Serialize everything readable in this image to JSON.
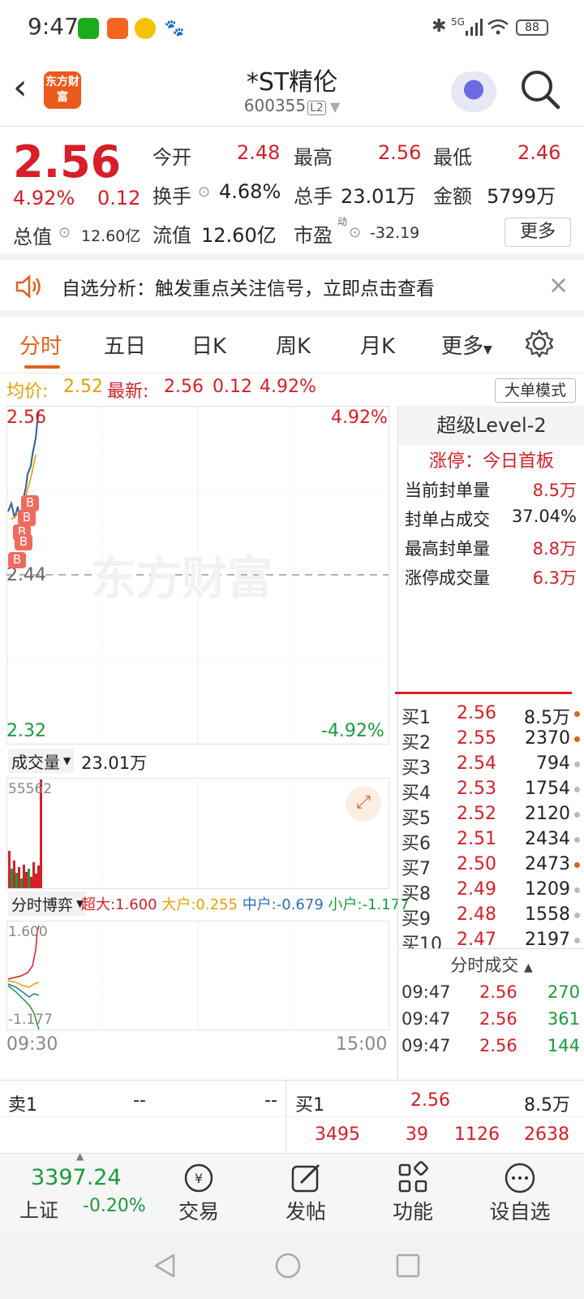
{
  "status_bar": {
    "time": "9:47",
    "battery": "88",
    "signal": "5G"
  },
  "header": {
    "back": "‹",
    "logo_text": "东方财富",
    "stock_name": "*ST精伦",
    "stock_code": "600355",
    "level_badge": "L2"
  },
  "quote": {
    "price": "2.56",
    "change_pct": "4.92%",
    "change_amt": "0.12",
    "open_label": "今开",
    "open": "2.48",
    "high_label": "最高",
    "high": "2.56",
    "low_label": "最低",
    "low": "2.46",
    "turnover_label": "换手",
    "turnover": "4.68%",
    "volume_label": "总手",
    "volume": "23.01万",
    "amount_label": "金额",
    "amount": "5799万",
    "mktcap_label": "总值",
    "mktcap": "12.60亿",
    "float_label": "流值",
    "float_cap": "12.60亿",
    "pe_label": "市盈",
    "pe_sup": "动",
    "pe": "-32.19",
    "more_label": "更多"
  },
  "notice": {
    "text": "自选分析：触发重点关注信号，立即点击查看",
    "close": "×"
  },
  "tabs": [
    "分时",
    "五日",
    "日K",
    "周K",
    "月K",
    "更多",
    "设置"
  ],
  "info_row": {
    "avg_label": "均价:",
    "avg": "2.52",
    "latest_label": "最新:",
    "latest": "2.56",
    "chg": "0.12",
    "pct": "4.92%",
    "big_order_btn": "大单模式"
  },
  "chart": {
    "top_price": "2.56",
    "top_pct": "4.92%",
    "mid_price": "2.44",
    "bottom_price": "2.32",
    "bottom_pct": "-4.92%",
    "watermark": "东方财富",
    "volume_selector": "成交量",
    "volume_total": "23.01万",
    "volume_max": "55562",
    "game_selector": "分时博弈",
    "super_label": "超大:",
    "super": "1.600",
    "big_label": "大户:",
    "big": "0.255",
    "mid_label": "中户:",
    "mid": "-0.679",
    "small_label": "小户:",
    "small": "-1.177",
    "game_top": "1.600",
    "game_bottom": "-1.177",
    "time_start": "09:30",
    "time_end": "15:00",
    "b_marker": "B"
  },
  "level2": {
    "title": "超级Level-2",
    "limit_label": "涨停：今日首板",
    "rows": [
      {
        "label": "当前封单量",
        "value": "8.5万"
      },
      {
        "label": "封单占成交",
        "value": "37.04%"
      },
      {
        "label": "最高封单量",
        "value": "8.8万"
      },
      {
        "label": "涨停成交量",
        "value": "6.3万"
      }
    ],
    "bids": [
      {
        "label": "买1",
        "price": "2.56",
        "vol": "8.5万",
        "dot": "#e0631b"
      },
      {
        "label": "买2",
        "price": "2.55",
        "vol": "2370",
        "dot": "#e0631b"
      },
      {
        "label": "买3",
        "price": "2.54",
        "vol": "794",
        "dot": "#bbb"
      },
      {
        "label": "买4",
        "price": "2.53",
        "vol": "1754",
        "dot": "#bbb"
      },
      {
        "label": "买5",
        "price": "2.52",
        "vol": "2120",
        "dot": "#bbb"
      },
      {
        "label": "买6",
        "price": "2.51",
        "vol": "2434",
        "dot": "#bbb"
      },
      {
        "label": "买7",
        "price": "2.50",
        "vol": "2473",
        "dot": "#e0631b"
      },
      {
        "label": "买8",
        "price": "2.49",
        "vol": "1209",
        "dot": "#bbb"
      },
      {
        "label": "买9",
        "price": "2.48",
        "vol": "1558",
        "dot": "#bbb"
      },
      {
        "label": "买10",
        "price": "2.47",
        "vol": "2197",
        "dot": "#bbb"
      }
    ],
    "trades_title": "分时成交",
    "trades": [
      {
        "time": "09:47",
        "price": "2.56",
        "vol": "270"
      },
      {
        "time": "09:47",
        "price": "2.56",
        "vol": "361"
      },
      {
        "time": "09:47",
        "price": "2.56",
        "vol": "144"
      }
    ]
  },
  "book": {
    "sell1_label": "卖1",
    "sell1_price": "--",
    "sell1_vol": "--",
    "buy1_label": "买1",
    "buy1_price": "2.56",
    "buy1_vol": "8.5万",
    "queue": [
      "3495",
      "39",
      "1126",
      "2638"
    ]
  },
  "bottom_nav": {
    "index_value": "3397.24",
    "index_name": "上证",
    "index_change": "-0.20%",
    "items": [
      "交易",
      "发帖",
      "功能",
      "设自选"
    ]
  },
  "colors": {
    "up": "#d61f26",
    "down": "#1a9a3c",
    "accent": "#e0631b",
    "avg_line": "#e8a000"
  }
}
